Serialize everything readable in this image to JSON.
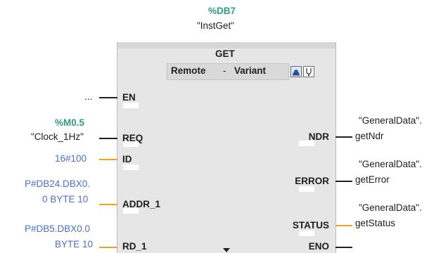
{
  "instance": {
    "db_address": "%DB7",
    "db_name": "\"InstGet\""
  },
  "block": {
    "name": "GET",
    "mode_left": "Remote",
    "separator": "-",
    "mode_right": "Variant"
  },
  "inputs": {
    "en": {
      "pin": "EN",
      "value": "..."
    },
    "req": {
      "pin": "REQ",
      "address": "%M0.5",
      "value": "\"Clock_1Hz\""
    },
    "id": {
      "pin": "ID",
      "value": "16#100"
    },
    "addr_1": {
      "pin": "ADDR_1",
      "value_line1": "P#DB24.DBX0.",
      "value_line2": "0 BYTE 10"
    },
    "rd_1": {
      "pin": "RD_1",
      "value_line1": "P#DB5.DBX0.0",
      "value_line2": "BYTE 10"
    }
  },
  "outputs": {
    "ndr": {
      "pin": "NDR",
      "value_line1": "\"GeneralData\".",
      "value_line2": "getNdr"
    },
    "error": {
      "pin": "ERROR",
      "value_line1": "\"GeneralData\".",
      "value_line2": "getError"
    },
    "status": {
      "pin": "STATUS",
      "value_line1": "\"GeneralData\".",
      "value_line2": "getStatus"
    },
    "eno": {
      "pin": "ENO"
    }
  },
  "colors": {
    "address_green": "#2e9e7c",
    "constant_blue": "#4a6fd1",
    "bool_wire": "#222222",
    "data_wire": "#f0a21c",
    "block_fill": "#e6e6e6"
  },
  "icons": {
    "instance_icon": "instance-db-icon",
    "diagnostic_icon": "stethoscope-icon",
    "expand_icon": "chevron-down-icon"
  }
}
